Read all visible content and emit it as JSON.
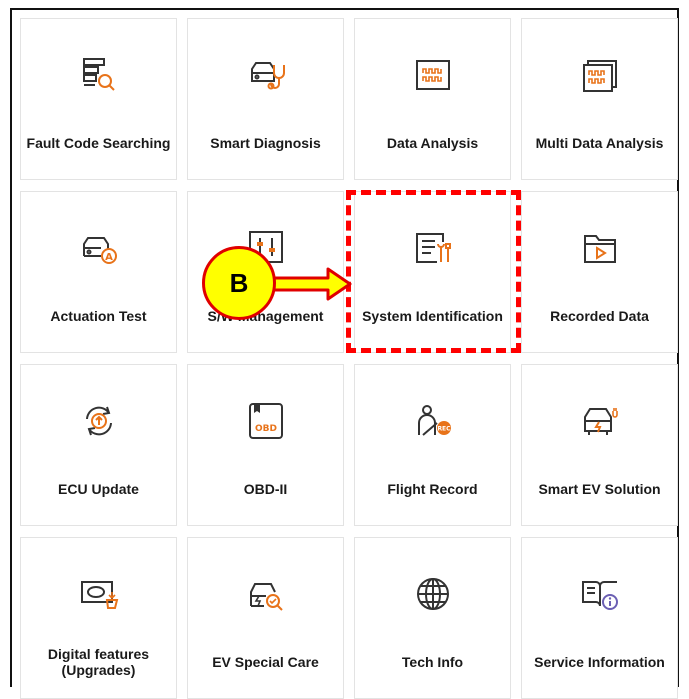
{
  "tiles": [
    {
      "label": "Fault Code Searching",
      "icon": "fault-code-search-icon"
    },
    {
      "label": "Smart Diagnosis",
      "icon": "smart-diagnosis-icon"
    },
    {
      "label": "Data Analysis",
      "icon": "data-analysis-icon"
    },
    {
      "label": "Multi Data Analysis",
      "icon": "multi-data-analysis-icon"
    },
    {
      "label": "Actuation Test",
      "icon": "actuation-test-icon"
    },
    {
      "label": "S/W Management",
      "icon": "sw-management-icon"
    },
    {
      "label": "System Identification",
      "icon": "system-identification-icon"
    },
    {
      "label": "Recorded Data",
      "icon": "recorded-data-icon"
    },
    {
      "label": "ECU Update",
      "icon": "ecu-update-icon"
    },
    {
      "label": "OBD-II",
      "icon": "obd-ii-icon"
    },
    {
      "label": "Flight Record",
      "icon": "flight-record-icon"
    },
    {
      "label": "Smart EV Solution",
      "icon": "smart-ev-solution-icon"
    },
    {
      "label": "Digital features (Upgrades)",
      "icon": "digital-features-icon"
    },
    {
      "label": "EV Special Care",
      "icon": "ev-special-care-icon"
    },
    {
      "label": "Tech Info",
      "icon": "tech-info-icon"
    },
    {
      "label": "Service Information",
      "icon": "service-information-icon"
    }
  ],
  "annotation": {
    "callout_letter": "B",
    "highlight_color": "#ff0000",
    "callout_fill": "#ffff00"
  },
  "colors": {
    "icon_dark": "#333333",
    "icon_accent": "#e8731a"
  }
}
